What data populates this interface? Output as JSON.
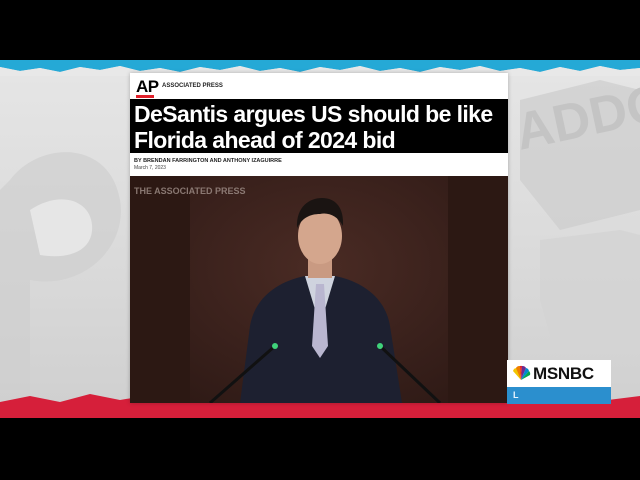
{
  "article": {
    "source_logo": "AP",
    "source_label": "ASSOCIATED PRESS",
    "headline_line1": "DeSantis argues US should be like",
    "headline_line2": "Florida ahead of 2024 bid",
    "byline": "BY BRENDAN FARRINGTON AND ANTHONY IZAGUIRRE",
    "date": "March 7, 2023"
  },
  "photo": {
    "watermark": "THE ASSOCIATED PRESS"
  },
  "network": {
    "logo_text": "MSNBC",
    "live_label": "L"
  },
  "colors": {
    "ap_red": "#e0202a",
    "headline_bg": "#000000",
    "msnbc_blue": "#2b8fce",
    "torn_edge_blue": "#25a9d6",
    "torn_edge_red": "#d61f3a"
  },
  "icons": [
    "peacock-icon"
  ]
}
